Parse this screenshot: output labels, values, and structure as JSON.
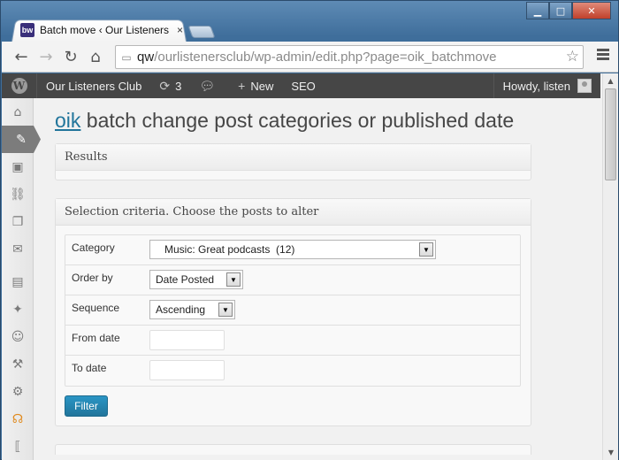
{
  "browser": {
    "tab_title": "Batch move ‹ Our Listeners",
    "tab_close": "×",
    "favicon_text": "bw",
    "url_host": "qw",
    "url_rest": "/ourlistenersclub/wp-admin/edit.php?page=oik_batchmove"
  },
  "adminbar": {
    "site_name": "Our Listeners Club",
    "updates_count": "3",
    "new_label": "New",
    "seo_label": "SEO",
    "howdy": "Howdy, listen"
  },
  "page": {
    "title_link": "oik",
    "title_rest": " batch change post categories or published date"
  },
  "results_box": {
    "title": "Results"
  },
  "criteria_box": {
    "title": "Selection criteria. Choose the posts to alter",
    "rows": [
      {
        "label": "Category",
        "value": "   Music: Great podcasts  (12)"
      },
      {
        "label": "Order by",
        "value": "Date Posted"
      },
      {
        "label": "Sequence",
        "value": "Ascending"
      },
      {
        "label": "From date",
        "value": ""
      },
      {
        "label": "To date",
        "value": ""
      }
    ],
    "filter_button": "Filter"
  },
  "colors": {
    "adminbar_bg": "#464646",
    "link": "#21759b",
    "button": "#21759b"
  }
}
